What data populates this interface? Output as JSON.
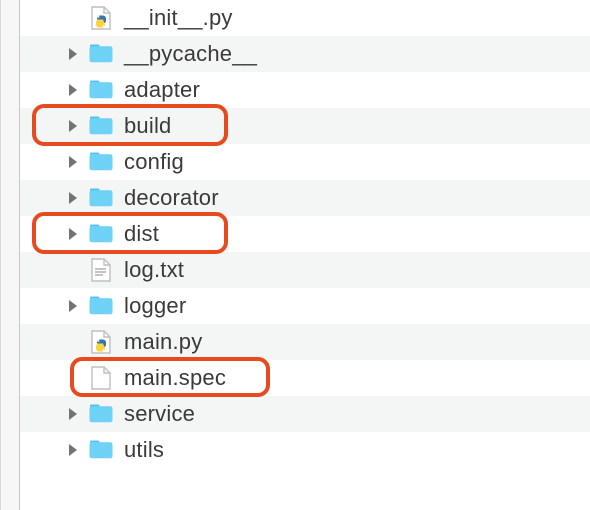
{
  "tree": {
    "items": [
      {
        "label": "__init__.py",
        "type": "python",
        "expandable": false,
        "highlighted": false
      },
      {
        "label": "__pycache__",
        "type": "folder",
        "expandable": true,
        "highlighted": false
      },
      {
        "label": "adapter",
        "type": "folder",
        "expandable": true,
        "highlighted": false
      },
      {
        "label": "build",
        "type": "folder",
        "expandable": true,
        "highlighted": true
      },
      {
        "label": "config",
        "type": "folder",
        "expandable": true,
        "highlighted": false
      },
      {
        "label": "decorator",
        "type": "folder",
        "expandable": true,
        "highlighted": false
      },
      {
        "label": "dist",
        "type": "folder",
        "expandable": true,
        "highlighted": true
      },
      {
        "label": "log.txt",
        "type": "text",
        "expandable": false,
        "highlighted": false
      },
      {
        "label": "logger",
        "type": "folder",
        "expandable": true,
        "highlighted": false
      },
      {
        "label": "main.py",
        "type": "python",
        "expandable": false,
        "highlighted": false
      },
      {
        "label": "main.spec",
        "type": "file",
        "expandable": false,
        "highlighted": true
      },
      {
        "label": "service",
        "type": "folder",
        "expandable": true,
        "highlighted": false
      },
      {
        "label": "utils",
        "type": "folder",
        "expandable": true,
        "highlighted": false
      }
    ]
  },
  "colors": {
    "folder_fill": "#6ed2f7",
    "folder_tab": "#55c5f0",
    "highlight": "#e84a1f"
  }
}
